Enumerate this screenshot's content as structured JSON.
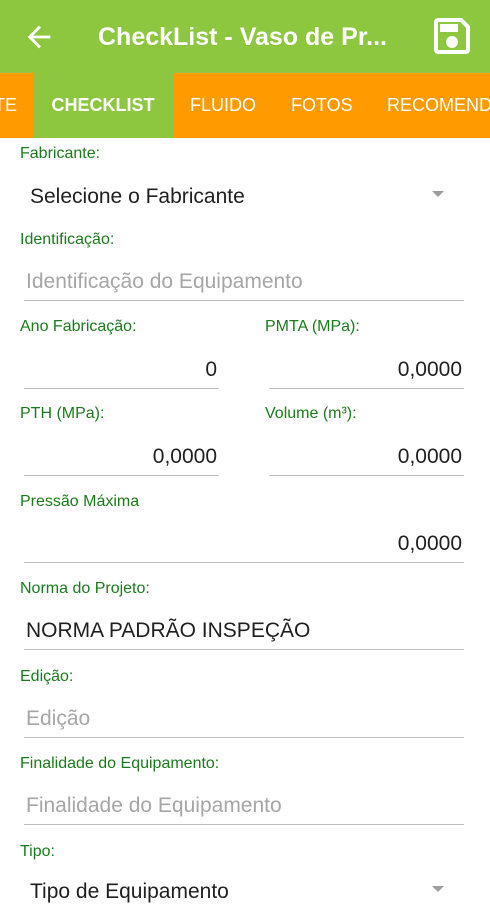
{
  "appbar": {
    "title": "CheckList - Vaso de Pr...",
    "color": "#8dc63f"
  },
  "tabs": [
    {
      "label": "TE",
      "active": false
    },
    {
      "label": "CHECKLIST",
      "active": true
    },
    {
      "label": "FLUIDO",
      "active": false
    },
    {
      "label": "FOTOS",
      "active": false
    },
    {
      "label": "RECOMEND",
      "active": false
    }
  ],
  "tab_color": "#ff9b00",
  "label_color": "#1b7a1b",
  "form": {
    "fabricante": {
      "label": "Fabricante:",
      "value": "Selecione o Fabricante"
    },
    "identificacao": {
      "label": "Identificação:",
      "placeholder": "Identificação do Equipamento"
    },
    "ano_fabricacao": {
      "label": "Ano Fabricação:",
      "value": "0"
    },
    "pmta": {
      "label": "PMTA (MPa):",
      "value": "0,0000"
    },
    "pth": {
      "label": "PTH (MPa):",
      "value": "0,0000"
    },
    "volume": {
      "label": "Volume (m³):",
      "value": "0,0000"
    },
    "pressao_maxima": {
      "label": "Pressão Máxima",
      "value": "0,0000"
    },
    "norma": {
      "label": "Norma do Projeto:",
      "value": "NORMA PADRÃO INSPEÇÃO"
    },
    "edicao": {
      "label": "Edição:",
      "placeholder": "Edição"
    },
    "finalidade": {
      "label": "Finalidade do Equipamento:",
      "placeholder": "Finalidade do Equipamento"
    },
    "tipo": {
      "label": "Tipo:",
      "value": "Tipo de Equipamento"
    }
  }
}
